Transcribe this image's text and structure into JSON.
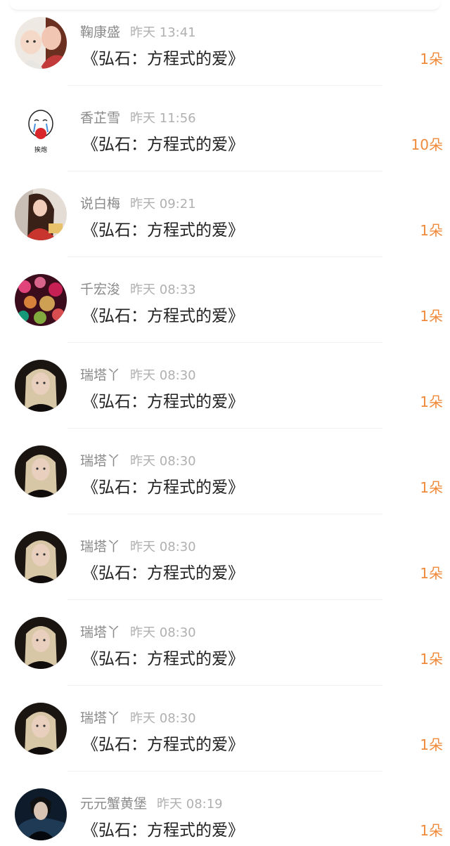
{
  "colors": {
    "name": "#8a8a8a",
    "time": "#b0b0b0",
    "title": "#222222",
    "count": "#f08a3a",
    "divider": "#f1f1f1"
  },
  "items": [
    {
      "name": "鞠康盛",
      "time": "昨天 13:41",
      "title": "《弘石：方程式的爱》",
      "count": "1朵",
      "avatar": "avatar-mother-child"
    },
    {
      "name": "香芷雪",
      "time": "昨天 11:56",
      "title": "《弘石：方程式的爱》",
      "count": "10朵",
      "avatar": "avatar-cartoon",
      "avatar_text": "挨炮"
    },
    {
      "name": "说白梅",
      "time": "昨天 09:21",
      "title": "《弘石：方程式的爱》",
      "count": "1朵",
      "avatar": "avatar-woman-red"
    },
    {
      "name": "千宏浚",
      "time": "昨天 08:33",
      "title": "《弘石：方程式的爱》",
      "count": "1朵",
      "avatar": "avatar-bokeh"
    },
    {
      "name": "瑞塔丫",
      "time": "昨天 08:30",
      "title": "《弘石：方程式的爱》",
      "count": "1朵",
      "avatar": "avatar-blonde"
    },
    {
      "name": "瑞塔丫",
      "time": "昨天 08:30",
      "title": "《弘石：方程式的爱》",
      "count": "1朵",
      "avatar": "avatar-blonde"
    },
    {
      "name": "瑞塔丫",
      "time": "昨天 08:30",
      "title": "《弘石：方程式的爱》",
      "count": "1朵",
      "avatar": "avatar-blonde"
    },
    {
      "name": "瑞塔丫",
      "time": "昨天 08:30",
      "title": "《弘石：方程式的爱》",
      "count": "1朵",
      "avatar": "avatar-blonde"
    },
    {
      "name": "瑞塔丫",
      "time": "昨天 08:30",
      "title": "《弘石：方程式的爱》",
      "count": "1朵",
      "avatar": "avatar-blonde"
    },
    {
      "name": "元元蟹黄堡",
      "time": "昨天 08:19",
      "title": "《弘石：方程式的爱》",
      "count": "1朵",
      "avatar": "avatar-dark-man"
    }
  ]
}
